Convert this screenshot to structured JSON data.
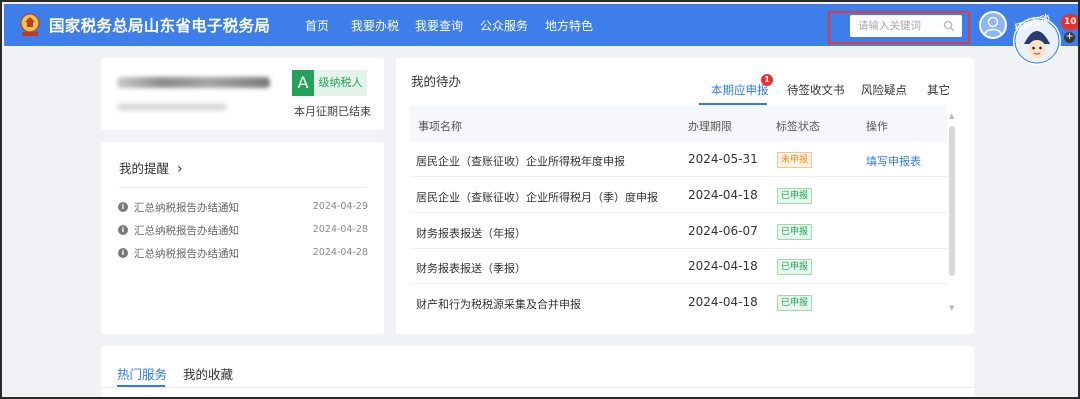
{
  "header": {
    "site_title": "国家税务总局山东省电子税务局",
    "nav": [
      "首页",
      "我要办税",
      "我要查询",
      "公众服务",
      "地方特色"
    ],
    "search_placeholder": "请输入关键词",
    "notification_count": "10",
    "mascot_text": "征纳互动",
    "plus": "+"
  },
  "taxpayer": {
    "grade_letter": "A",
    "grade_label": "级纳税人",
    "period_status": "本月征期已结束"
  },
  "reminders": {
    "title": "我的提醒",
    "title_arrow": "›",
    "info_glyph": "i",
    "items": [
      {
        "text": "汇总纳税报告办结通知",
        "date": "2024-04-29"
      },
      {
        "text": "汇总纳税报告办结通知",
        "date": "2024-04-28"
      },
      {
        "text": "汇总纳税报告办结通知",
        "date": "2024-04-28"
      }
    ]
  },
  "todo": {
    "title": "我的待办",
    "tabs": [
      "本期应申报",
      "待签收文书",
      "风险疑点",
      "其它"
    ],
    "active_tab_badge": "1",
    "columns": [
      "事项名称",
      "办理期限",
      "标签状态",
      "操作"
    ],
    "rows": [
      {
        "name": "居民企业（查账征收）企业所得税年度申报",
        "deadline": "2024-05-31",
        "status": "未申报",
        "action": "填写申报表"
      },
      {
        "name": "居民企业（查账征收）企业所得税月（季）度申报",
        "deadline": "2024-04-18",
        "status": "已申报",
        "action": ""
      },
      {
        "name": "财务报表报送（年报）",
        "deadline": "2024-06-07",
        "status": "已申报",
        "action": ""
      },
      {
        "name": "财务报表报送（季报）",
        "deadline": "2024-04-18",
        "status": "已申报",
        "action": ""
      },
      {
        "name": "财产和行为税税源采集及合并申报",
        "deadline": "2024-04-18",
        "status": "已申报",
        "action": ""
      }
    ]
  },
  "services": {
    "tabs": [
      "热门服务",
      "我的收藏"
    ]
  },
  "colors": {
    "header_bg": "#3d7eea",
    "accent": "#2f7de1",
    "grade_green": "#25a25a",
    "status_pending_bg": "#fff3e6",
    "status_pending_fg": "#f08a1c",
    "status_done_bg": "#e8f7ec",
    "status_done_fg": "#25a25a",
    "badge_red": "#e5322d",
    "highlight_red": "#e23b3b"
  }
}
